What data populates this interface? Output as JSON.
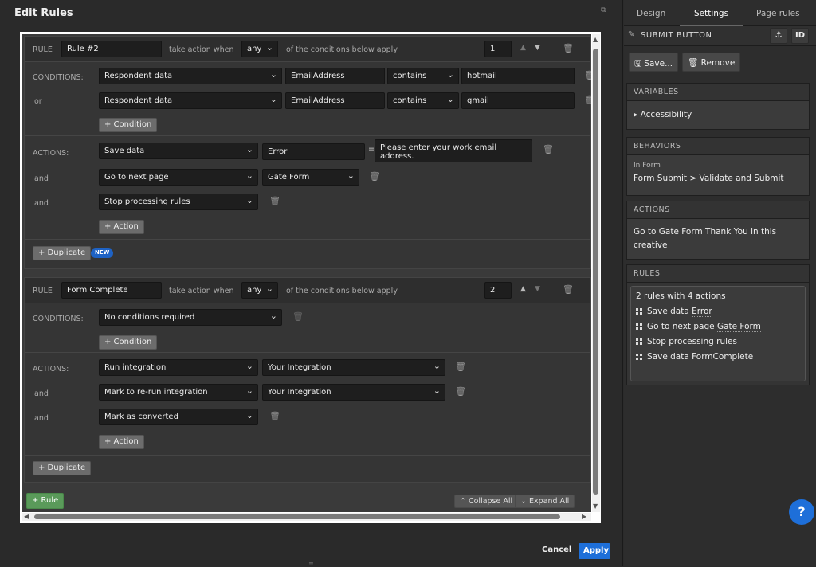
{
  "modal": {
    "title": "Edit Rules",
    "cancel": "Cancel",
    "apply": "Apply"
  },
  "labels": {
    "rule": "RULE",
    "take_action": "take action when",
    "conditions_below": "of the conditions below apply",
    "conditions": "CONDITIONS:",
    "actions": "ACTIONS:",
    "or": "or",
    "and": "and",
    "add_condition": "+ Condition",
    "add_action": "+ Action",
    "duplicate": "+ Duplicate",
    "new": "NEW",
    "add_rule": "+ Rule",
    "collapse_all": "Collapse All",
    "expand_all": "Expand All"
  },
  "rule1": {
    "name": "Rule #2",
    "match": "any",
    "order": "1",
    "conditions": [
      {
        "source": "Respondent data",
        "field": "EmailAddress",
        "op": "contains",
        "value": "hotmail"
      },
      {
        "source": "Respondent data",
        "field": "EmailAddress",
        "op": "contains",
        "value": "gmail"
      }
    ],
    "actions": [
      {
        "type": "Save data",
        "target": "Error",
        "extra": "Please enter your work email address."
      },
      {
        "type": "Go to next page",
        "target": "Gate Form"
      },
      {
        "type": "Stop processing rules"
      }
    ]
  },
  "rule2": {
    "name": "Form Complete",
    "match": "any",
    "order": "2",
    "condition": "No conditions required",
    "actions": [
      {
        "type": "Run integration",
        "target": "Your Integration"
      },
      {
        "type": "Mark to re-run integration",
        "target": "Your Integration"
      },
      {
        "type": "Mark as converted"
      }
    ]
  },
  "panel": {
    "tabs": [
      "Design",
      "Settings",
      "Page rules"
    ],
    "subtitle": "SUBMIT BUTTON",
    "id_btn": "ID",
    "save": "Save...",
    "remove": "Remove",
    "variables_h": "VARIABLES",
    "accessibility": "Accessibility",
    "behaviors_h": "BEHAVIORS",
    "behaviors_sub": "In Form",
    "behaviors_val": "Form Submit > Validate and Submit",
    "actions_h": "ACTIONS",
    "actions_pre": "Go to ",
    "actions_link": "Gate Form Thank You",
    "actions_post": " in this creative",
    "rules_h": "RULES",
    "rules_summary": "2 rules with 4 actions",
    "rules_list": [
      {
        "text": "Save data ",
        "link": "Error"
      },
      {
        "text": "Go to next page ",
        "link": "Gate Form"
      },
      {
        "text": "Stop processing rules",
        "link": ""
      },
      {
        "text": "Save data ",
        "link": "FormComplete"
      }
    ],
    "help": "?"
  }
}
